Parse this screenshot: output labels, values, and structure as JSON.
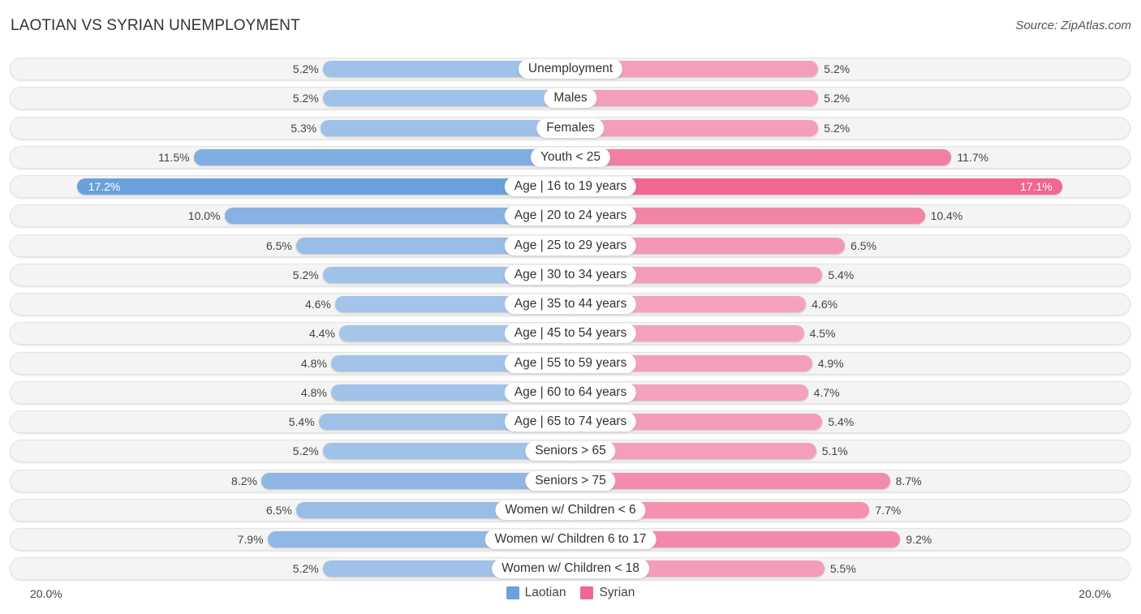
{
  "header": {
    "title": "LAOTIAN VS SYRIAN UNEMPLOYMENT",
    "source": "Source: ZipAtlas.com"
  },
  "colors": {
    "laotian": "#6aa0dc",
    "laotian_light": "#a9c7ea",
    "syrian": "#f06792",
    "syrian_light": "#f5a8c0"
  },
  "chart_data": {
    "type": "bar",
    "orientation": "horizontal-diverging",
    "title": "LAOTIAN VS SYRIAN UNEMPLOYMENT",
    "categories": [
      "Unemployment",
      "Males",
      "Females",
      "Youth < 25",
      "Age | 16 to 19 years",
      "Age | 20 to 24 years",
      "Age | 25 to 29 years",
      "Age | 30 to 34 years",
      "Age | 35 to 44 years",
      "Age | 45 to 54 years",
      "Age | 55 to 59 years",
      "Age | 60 to 64 years",
      "Age | 65 to 74 years",
      "Seniors > 65",
      "Seniors > 75",
      "Women w/ Children < 6",
      "Women w/ Children 6 to 17",
      "Women w/ Children < 18"
    ],
    "series": [
      {
        "name": "Laotian",
        "side": "left",
        "values": [
          5.2,
          5.2,
          5.3,
          11.5,
          17.2,
          10.0,
          6.5,
          5.2,
          4.6,
          4.4,
          4.8,
          4.8,
          5.4,
          5.2,
          8.2,
          6.5,
          7.9,
          5.2
        ],
        "labels": [
          "5.2%",
          "5.2%",
          "5.3%",
          "11.5%",
          "17.2%",
          "10.0%",
          "6.5%",
          "5.2%",
          "4.6%",
          "4.4%",
          "4.8%",
          "4.8%",
          "5.4%",
          "5.2%",
          "8.2%",
          "6.5%",
          "7.9%",
          "5.2%"
        ]
      },
      {
        "name": "Syrian",
        "side": "right",
        "values": [
          5.2,
          5.2,
          5.2,
          11.7,
          17.1,
          10.4,
          6.5,
          5.4,
          4.6,
          4.5,
          4.9,
          4.7,
          5.4,
          5.1,
          8.7,
          7.7,
          9.2,
          5.5
        ],
        "labels": [
          "5.2%",
          "5.2%",
          "5.2%",
          "11.7%",
          "17.1%",
          "10.4%",
          "6.5%",
          "5.4%",
          "4.6%",
          "4.5%",
          "4.9%",
          "4.7%",
          "5.4%",
          "5.1%",
          "8.7%",
          "7.7%",
          "9.2%",
          "5.5%"
        ]
      }
    ],
    "axis": {
      "min_label": "20.0%",
      "max_label": "20.0%",
      "range": [
        0,
        20
      ]
    },
    "legend": {
      "position": "bottom-center",
      "entries": [
        "Laotian",
        "Syrian"
      ]
    },
    "grid": false
  }
}
